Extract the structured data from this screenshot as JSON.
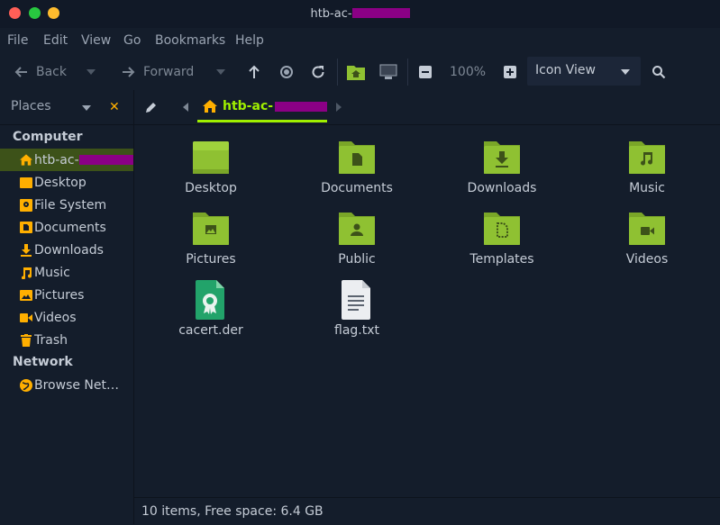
{
  "window": {
    "title_prefix": "htb-ac-"
  },
  "menubar": {
    "items": [
      "File",
      "Edit",
      "View",
      "Go",
      "Bookmarks",
      "Help"
    ]
  },
  "toolbar": {
    "back_label": "Back",
    "forward_label": "Forward",
    "zoom_level": "100%",
    "view_mode": "Icon View"
  },
  "sidebar": {
    "places_label": "Places",
    "sections": [
      {
        "title": "Computer"
      },
      {
        "title": "Network"
      }
    ],
    "computer_items": [
      {
        "label": "htb-ac-",
        "icon": "home-icon",
        "selected": true
      },
      {
        "label": "Desktop",
        "icon": "desktop-icon"
      },
      {
        "label": "File System",
        "icon": "drive-icon"
      },
      {
        "label": "Documents",
        "icon": "documents-icon"
      },
      {
        "label": "Downloads",
        "icon": "download-icon"
      },
      {
        "label": "Music",
        "icon": "music-icon"
      },
      {
        "label": "Pictures",
        "icon": "pictures-icon"
      },
      {
        "label": "Videos",
        "icon": "videos-icon"
      },
      {
        "label": "Trash",
        "icon": "trash-icon"
      }
    ],
    "network_items": [
      {
        "label": "Browse Netw…",
        "icon": "network-icon"
      }
    ]
  },
  "pathbar": {
    "current_label": "htb-ac-"
  },
  "files": [
    {
      "name": "Desktop",
      "kind": "folder-desktop"
    },
    {
      "name": "Documents",
      "kind": "folder-documents"
    },
    {
      "name": "Downloads",
      "kind": "folder-downloads"
    },
    {
      "name": "Music",
      "kind": "folder-music"
    },
    {
      "name": "Pictures",
      "kind": "folder-pictures"
    },
    {
      "name": "Public",
      "kind": "folder-public"
    },
    {
      "name": "Templates",
      "kind": "folder-templates"
    },
    {
      "name": "Videos",
      "kind": "folder-videos"
    },
    {
      "name": "cacert.der",
      "kind": "certificate"
    },
    {
      "name": "flag.txt",
      "kind": "text-file"
    }
  ],
  "status": {
    "text": "10 items, Free space: 6.4 GB"
  },
  "colors": {
    "accent": "#9fef00",
    "places_orange": "#ffaf00",
    "folder_green": "#8fc132",
    "background": "#141d2b",
    "redaction": "#8b0085"
  }
}
